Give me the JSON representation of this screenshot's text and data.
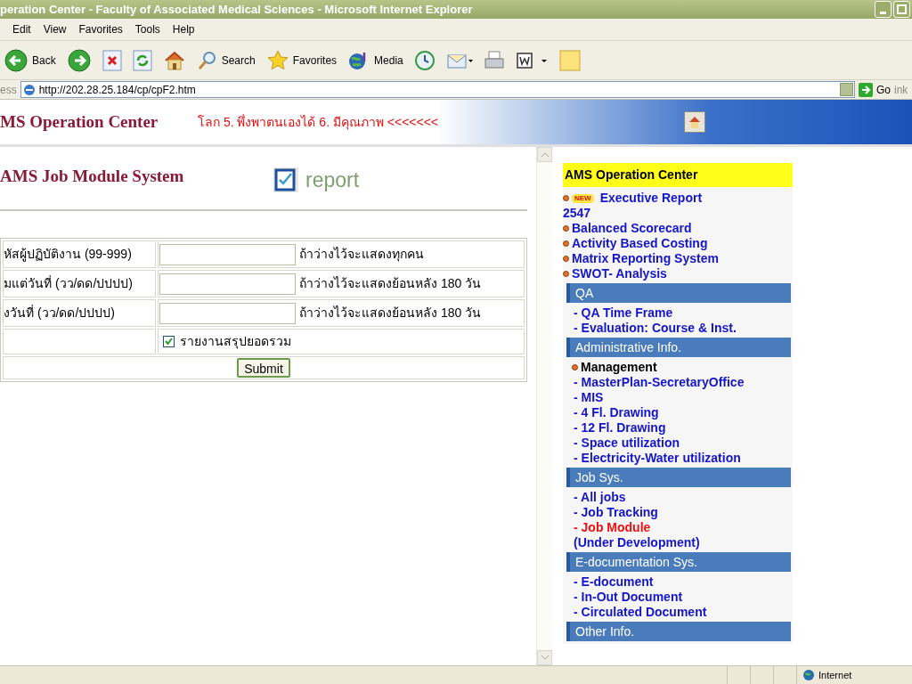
{
  "window": {
    "title": "peration Center - Faculty of Associated Medical Sciences - Microsoft Internet Explorer"
  },
  "menu_bar": [
    "Edit",
    "View",
    "Favorites",
    "Tools",
    "Help"
  ],
  "toolbar": [
    {
      "kind": "back",
      "label": "Back"
    },
    {
      "kind": "forward"
    },
    {
      "kind": "stop"
    },
    {
      "kind": "refresh"
    },
    {
      "kind": "home"
    },
    {
      "kind": "search",
      "label": "Search"
    },
    {
      "kind": "favorites",
      "label": "Favorites"
    },
    {
      "kind": "media",
      "label": "Media"
    },
    {
      "kind": "history"
    },
    {
      "kind": "mail"
    },
    {
      "kind": "print"
    },
    {
      "kind": "word"
    },
    {
      "kind": "note"
    }
  ],
  "address_bar": {
    "label": "ess",
    "url": "http://202.28.25.184/cp/cpF2.htm",
    "go": "Go",
    "links": "ink"
  },
  "header": {
    "title": "MS Operation Center",
    "marquee": "โลก 5. พึ่งพาตนเองได้ 6. มีคุณภาพ <<<<<<<"
  },
  "content": {
    "title": "AMS Job Module System",
    "report": "report",
    "form": [
      {
        "label": "หัสผู้ปฏิบัติงาน (99-999)",
        "hint": "ถ้าว่างไว้จะแสดงทุกคน"
      },
      {
        "label": "มแต่วันที่ (วว/ดด/ปปปป)",
        "hint": "ถ้าว่างไว้จะแสดงย้อนหลัง 180 วัน"
      },
      {
        "label": "งวันที่ (วว/ดด/ปปปป)",
        "hint": "ถ้าว่างไว้จะแสดงย้อนหลัง 180 วัน"
      }
    ],
    "summary": {
      "label": "รายงานสรุปยอดรวม",
      "checked": true
    },
    "submit": "Submit"
  },
  "sidebar": {
    "title": "AMS Operation Center",
    "items": [
      {
        "kind": "bullet",
        "label": "Executive Report",
        "badge": "NEW",
        "subtitle": "2547"
      },
      {
        "kind": "bullet",
        "label": "Balanced Scorecard"
      },
      {
        "kind": "bullet",
        "label": "Activity Based Costing"
      },
      {
        "kind": "bullet",
        "label": "Matrix Reporting System"
      },
      {
        "kind": "bullet",
        "label": "SWOT- Analysis"
      },
      {
        "kind": "section",
        "label": "QA"
      },
      {
        "kind": "link",
        "label": "- QA Time Frame",
        "selected": false
      },
      {
        "kind": "link",
        "label": "- Evaluation: Course & Inst.",
        "selected": false
      },
      {
        "kind": "section",
        "label": "Administrative Info."
      },
      {
        "kind": "group",
        "label": "Management"
      },
      {
        "kind": "link",
        "label": "- MasterPlan-SecretaryOffice",
        "selected": false
      },
      {
        "kind": "link",
        "label": "- MIS",
        "selected": false
      },
      {
        "kind": "link",
        "label": "- 4 Fl. Drawing",
        "selected": false
      },
      {
        "kind": "link",
        "label": "- 12 Fl. Drawing",
        "selected": false
      },
      {
        "kind": "link",
        "label": "- Space utilization",
        "selected": false
      },
      {
        "kind": "link",
        "label": "- Electricity-Water utilization",
        "selected": false
      },
      {
        "kind": "section",
        "label": "Job Sys."
      },
      {
        "kind": "link",
        "label": "- All jobs",
        "selected": false
      },
      {
        "kind": "link",
        "label": "- Job Tracking",
        "selected": false
      },
      {
        "kind": "link",
        "label": "- Job Module",
        "selected": true
      },
      {
        "kind": "link",
        "label": "(Under Development)",
        "selected": false
      },
      {
        "kind": "section",
        "label": "E-documentation Sys."
      },
      {
        "kind": "link",
        "label": "- E-document",
        "selected": false
      },
      {
        "kind": "link",
        "label": "- In-Out Document",
        "selected": false
      },
      {
        "kind": "link",
        "label": "- Circulated Document",
        "selected": false
      },
      {
        "kind": "section",
        "label": "Other Info."
      }
    ]
  },
  "status_bar": {
    "zone": "Internet"
  }
}
